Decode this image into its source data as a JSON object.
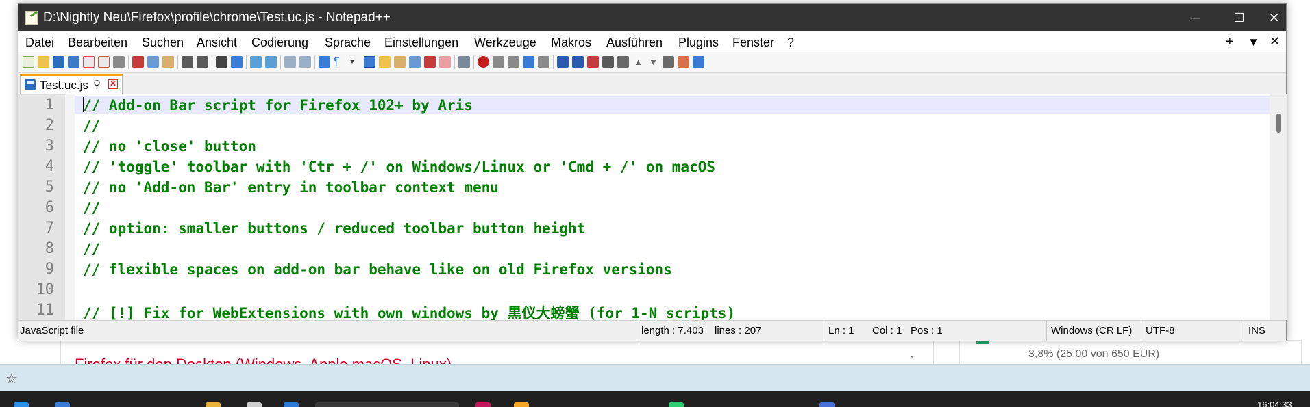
{
  "window": {
    "title": "D:\\Nightly Neu\\Firefox\\profile\\chrome\\Test.uc.js - Notepad++",
    "minimize": "─",
    "maximize": "☐",
    "close": "✕"
  },
  "menu": {
    "items": [
      "Datei",
      "Bearbeiten",
      "Suchen",
      "Ansicht",
      "Codierung",
      "Sprache",
      "Einstellungen",
      "Werkzeuge",
      "Makros",
      "Ausführen",
      "Plugins",
      "Fenster",
      "?"
    ],
    "right_controls": [
      "+",
      "▼",
      "✕"
    ]
  },
  "toolbar": {
    "accent": "#2a6ebc"
  },
  "tab": {
    "label": "Test.uc.js",
    "pin_glyph": "⚲",
    "close_glyph": "✕"
  },
  "editor": {
    "lines": [
      {
        "num": "1",
        "text": "// Add-on Bar script for Firefox 102+ by Aris"
      },
      {
        "num": "2",
        "text": "//"
      },
      {
        "num": "3",
        "text": "// no 'close' button"
      },
      {
        "num": "4",
        "text": "// 'toggle' toolbar with 'Ctr + /' on Windows/Linux or 'Cmd + /' on macOS"
      },
      {
        "num": "5",
        "text": "// no 'Add-on Bar' entry in toolbar context menu"
      },
      {
        "num": "6",
        "text": "//"
      },
      {
        "num": "7",
        "text": "// option: smaller buttons / reduced toolbar button height"
      },
      {
        "num": "8",
        "text": "//"
      },
      {
        "num": "9",
        "text": "// flexible spaces on add-on bar behave like on old Firefox versions"
      },
      {
        "num": "10",
        "text": ""
      },
      {
        "num": "11",
        "text": "// [!] Fix for WebExtensions with own windows by 黒仪大螃蟹 (for 1-N scripts)"
      }
    ],
    "comment_color": "#008000"
  },
  "status": {
    "filetype": "JavaScript file",
    "length": "length : 7.403",
    "lines": "lines : 207",
    "ln": "Ln : 1",
    "col": "Col : 1",
    "pos": "Pos : 1",
    "eol": "Windows (CR LF)",
    "encoding": "UTF-8",
    "mode": "INS"
  },
  "background": {
    "page_link": "Firefox für den Desktop (Windows, Apple macOS, Linux)",
    "progress_text": "3,8% (25,00 von 650 EUR)",
    "progress_fraction": 0.038,
    "clock": "16:04:33"
  }
}
